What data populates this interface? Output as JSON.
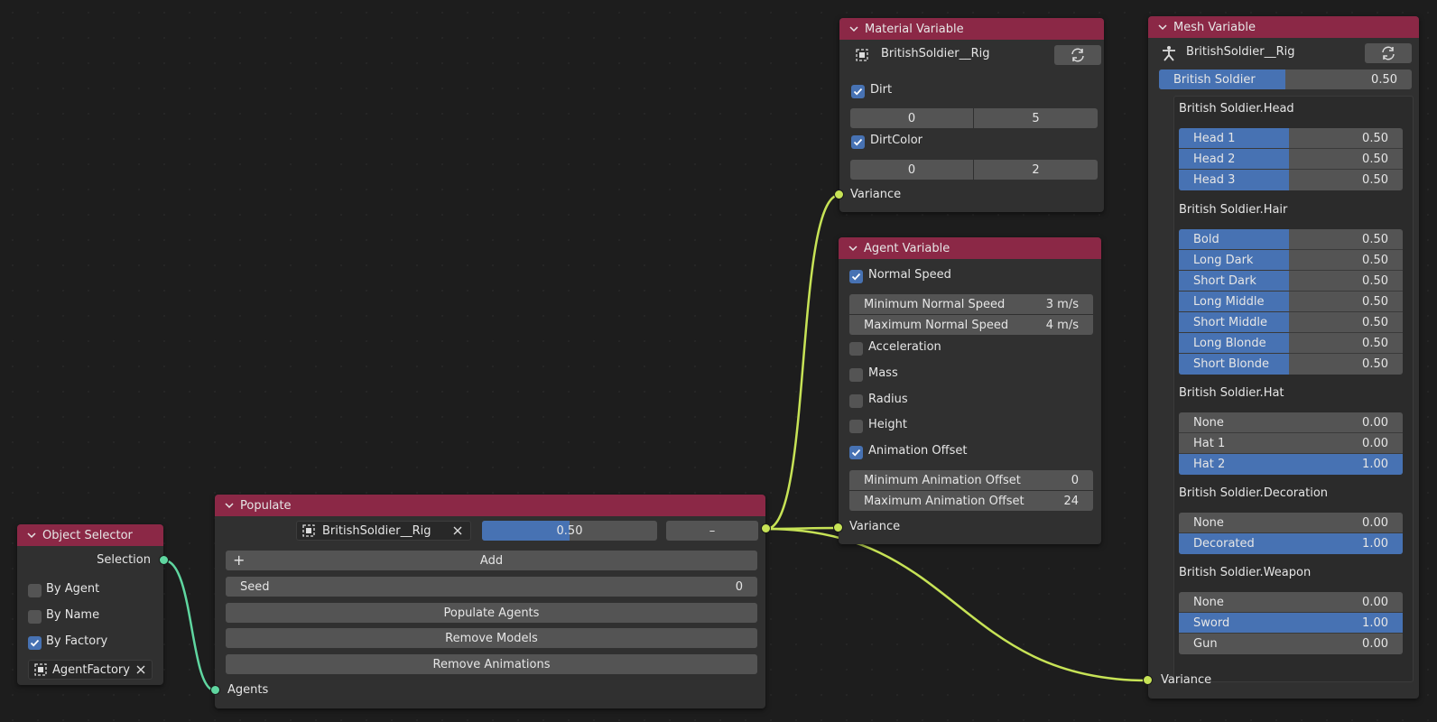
{
  "colors": {
    "header": "#8b2846",
    "accent": "#4772b3",
    "wire_yellow": "#c7e356",
    "wire_green": "#5fd6a0"
  },
  "object_selector": {
    "title": "Object Selector",
    "output_socket": "Selection",
    "options": [
      {
        "label": "By Agent",
        "checked": false
      },
      {
        "label": "By Name",
        "checked": false
      },
      {
        "label": "By Factory",
        "checked": true
      }
    ],
    "factory_field": "AgentFactory",
    "icons": {
      "object": "object-data-icon",
      "clear": "close-icon"
    }
  },
  "populate": {
    "title": "Populate",
    "object_field": "BritishSoldier__Rig",
    "weight": "0.50",
    "weight_fraction": 0.5,
    "minus_label": "–",
    "add_label": "Add",
    "seed_label": "Seed",
    "seed_value": "0",
    "populate_agents": "Populate Agents",
    "remove_models": "Remove Models",
    "remove_animations": "Remove Animations",
    "input_socket": "Agents"
  },
  "material_variable": {
    "title": "Material Variable",
    "object_field": "BritishSoldier__Rig",
    "dirt": {
      "label": "Dirt",
      "checked": true,
      "min": "0",
      "max": "5"
    },
    "dirt_color": {
      "label": "DirtColor",
      "checked": true,
      "min": "0",
      "max": "2"
    },
    "input_socket": "Variance"
  },
  "agent_variable": {
    "title": "Agent Variable",
    "normal_speed": {
      "label": "Normal Speed",
      "checked": true
    },
    "min_speed": {
      "label": "Minimum Normal Speed",
      "value": "3 m/s"
    },
    "max_speed": {
      "label": "Maximum Normal Speed",
      "value": "4 m/s"
    },
    "acceleration": {
      "label": "Acceleration",
      "checked": false
    },
    "mass": {
      "label": "Mass",
      "checked": false
    },
    "radius": {
      "label": "Radius",
      "checked": false
    },
    "height": {
      "label": "Height",
      "checked": false
    },
    "animation_offset": {
      "label": "Animation Offset",
      "checked": true
    },
    "min_anim": {
      "label": "Minimum Animation Offset",
      "value": "0"
    },
    "max_anim": {
      "label": "Maximum Animation Offset",
      "value": "24"
    },
    "input_socket": "Variance"
  },
  "mesh_variable": {
    "title": "Mesh Variable",
    "armature_field": "BritishSoldier__Rig",
    "root": {
      "name": "British Soldier",
      "value": "0.50",
      "fraction": 0.5
    },
    "groups": [
      {
        "title": "British Soldier.Head",
        "items": [
          {
            "name": "Head 1",
            "value": "0.50",
            "fraction": 0.5
          },
          {
            "name": "Head 2",
            "value": "0.50",
            "fraction": 0.5
          },
          {
            "name": "Head 3",
            "value": "0.50",
            "fraction": 0.5
          }
        ]
      },
      {
        "title": "British Soldier.Hair",
        "items": [
          {
            "name": "Bold",
            "value": "0.50",
            "fraction": 0.5
          },
          {
            "name": "Long Dark",
            "value": "0.50",
            "fraction": 0.5
          },
          {
            "name": "Short Dark",
            "value": "0.50",
            "fraction": 0.5
          },
          {
            "name": "Long Middle",
            "value": "0.50",
            "fraction": 0.5
          },
          {
            "name": "Short Middle",
            "value": "0.50",
            "fraction": 0.5
          },
          {
            "name": "Long Blonde",
            "value": "0.50",
            "fraction": 0.5
          },
          {
            "name": "Short Blonde",
            "value": "0.50",
            "fraction": 0.5
          }
        ]
      },
      {
        "title": "British Soldier.Hat",
        "items": [
          {
            "name": "None",
            "value": "0.00",
            "fraction": 0
          },
          {
            "name": "Hat 1",
            "value": "0.00",
            "fraction": 0
          },
          {
            "name": "Hat 2",
            "value": "1.00",
            "fraction": 1
          }
        ]
      },
      {
        "title": "British Soldier.Decoration",
        "items": [
          {
            "name": "None",
            "value": "0.00",
            "fraction": 0
          },
          {
            "name": "Decorated",
            "value": "1.00",
            "fraction": 1
          }
        ]
      },
      {
        "title": "British Soldier.Weapon",
        "items": [
          {
            "name": "None",
            "value": "0.00",
            "fraction": 0
          },
          {
            "name": "Sword",
            "value": "1.00",
            "fraction": 1
          },
          {
            "name": "Gun",
            "value": "0.00",
            "fraction": 0
          }
        ]
      }
    ],
    "input_socket": "Variance"
  }
}
